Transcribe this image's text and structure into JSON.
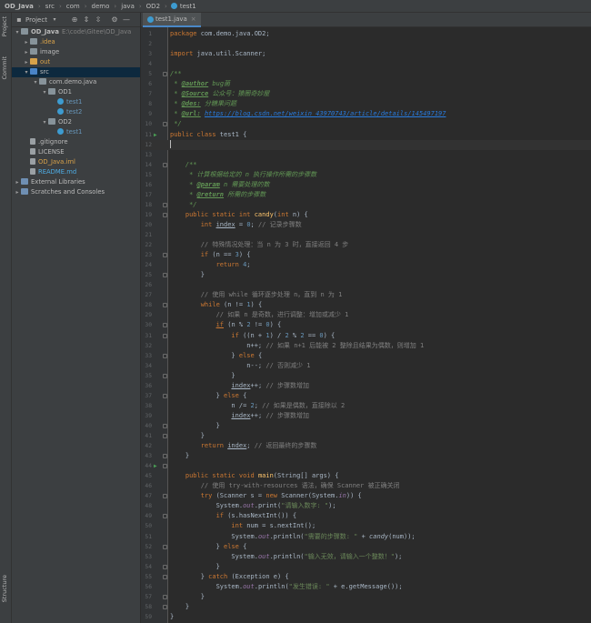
{
  "breadcrumb": [
    "OD_Java",
    "src",
    "com",
    "demo",
    "java",
    "OD2",
    "test1"
  ],
  "left_strip": {
    "top_tab": "Project",
    "commit_tab": "Commit",
    "bottom_tab": "Structure"
  },
  "project_panel": {
    "title": "Project",
    "tree": [
      {
        "indent": 0,
        "arrow": "▾",
        "icon": "folder",
        "label": "OD_Java",
        "extra": "E:\\code\\Gitee\\OD_Java",
        "bold": true
      },
      {
        "indent": 1,
        "arrow": "▸",
        "icon": "folder",
        "label": ".idea",
        "color": "orange"
      },
      {
        "indent": 1,
        "arrow": "▸",
        "icon": "folder",
        "label": "image"
      },
      {
        "indent": 1,
        "arrow": "▸",
        "icon": "folder-out",
        "label": "out",
        "color": "orange"
      },
      {
        "indent": 1,
        "arrow": "▾",
        "icon": "folder-src",
        "label": "src",
        "selected": true
      },
      {
        "indent": 2,
        "arrow": "▾",
        "icon": "pkg",
        "label": "com.demo.java"
      },
      {
        "indent": 3,
        "arrow": "▾",
        "icon": "pkg",
        "label": "OD1"
      },
      {
        "indent": 4,
        "arrow": "",
        "icon": "cls",
        "label": "test1",
        "color": "blue"
      },
      {
        "indent": 4,
        "arrow": "",
        "icon": "cls",
        "label": "test2",
        "color": "blue"
      },
      {
        "indent": 3,
        "arrow": "▾",
        "icon": "pkg",
        "label": "OD2"
      },
      {
        "indent": 4,
        "arrow": "",
        "icon": "cls",
        "label": "test1",
        "color": "blue"
      },
      {
        "indent": 1,
        "arrow": "",
        "icon": "file",
        "label": ".gitignore"
      },
      {
        "indent": 1,
        "arrow": "",
        "icon": "file",
        "label": "LICENSE"
      },
      {
        "indent": 1,
        "arrow": "",
        "icon": "file",
        "label": "OD_Java.iml",
        "color": "orange"
      },
      {
        "indent": 1,
        "arrow": "",
        "icon": "file",
        "label": "README.md",
        "color": "ml"
      },
      {
        "indent": 0,
        "arrow": "▸",
        "icon": "lib",
        "label": "External Libraries"
      },
      {
        "indent": 0,
        "arrow": "▸",
        "icon": "lib",
        "label": "Scratches and Consoles"
      }
    ]
  },
  "editor": {
    "tab_label": "test1.java",
    "lines": [
      [
        [
          "kw",
          "package "
        ],
        [
          "",
          "com.demo.java.OD2;"
        ]
      ],
      [],
      [
        [
          "kw",
          "import "
        ],
        [
          "",
          "java.util.Scanner;"
        ]
      ],
      [],
      [
        [
          "dc",
          "/**"
        ]
      ],
      [
        [
          "dc",
          " * "
        ],
        [
          "tg",
          "@author"
        ],
        [
          "dc",
          " bug菌"
        ]
      ],
      [
        [
          "dc",
          " * "
        ],
        [
          "tg",
          "@Source"
        ],
        [
          "dc",
          " 公众号：猿圈奇妙屋"
        ]
      ],
      [
        [
          "dc",
          " * "
        ],
        [
          "tg",
          "@des:"
        ],
        [
          "dc",
          " 分糖果问题"
        ]
      ],
      [
        [
          "dc",
          " * "
        ],
        [
          "tg",
          "@url:"
        ],
        [
          "dc",
          " "
        ],
        [
          "lnk",
          "https://blog.csdn.net/weixin_43970743/article/details/145497197"
        ]
      ],
      [
        [
          "dc",
          " */"
        ]
      ],
      [
        [
          "kw",
          "public class "
        ],
        [
          "",
          "test1 {"
        ]
      ],
      [],
      [],
      [
        [
          "dc",
          "    /**"
        ]
      ],
      [
        [
          "dc",
          "     * 计算根据给定的 n 执行操作所需的步骤数"
        ]
      ],
      [
        [
          "dc",
          "     * "
        ],
        [
          "tg",
          "@param"
        ],
        [
          "dc",
          " n 需要处理的数"
        ]
      ],
      [
        [
          "dc",
          "     * "
        ],
        [
          "tg",
          "@return"
        ],
        [
          "dc",
          " 所需的步骤数"
        ]
      ],
      [
        [
          "dc",
          "     */"
        ]
      ],
      [
        [
          "kw",
          "    public static int "
        ],
        [
          "fn",
          "candy"
        ],
        [
          "",
          "("
        ],
        [
          "kw",
          "int "
        ],
        [
          "",
          "n) {"
        ]
      ],
      [
        [
          "kw",
          "        int "
        ],
        [
          "ul",
          "index"
        ],
        [
          "",
          " = "
        ],
        [
          "num",
          "0"
        ],
        [
          "",
          ";"
        ],
        [
          "cm",
          " // 记录步骤数"
        ]
      ],
      [],
      [
        [
          "cm",
          "        // 特殊情况处理：当 n 为 3 时，直接返回 4 步"
        ]
      ],
      [
        [
          "kw",
          "        if "
        ],
        [
          "",
          "(n == "
        ],
        [
          "num",
          "3"
        ],
        [
          "",
          ") {"
        ]
      ],
      [
        [
          "kw",
          "            return "
        ],
        [
          "num",
          "4"
        ],
        [
          "",
          ";"
        ]
      ],
      [
        [
          "",
          "        }"
        ]
      ],
      [],
      [
        [
          "cm",
          "        // 使用 while 循环逐步处理 n，直到 n 为 1"
        ]
      ],
      [
        [
          "kw",
          "        while "
        ],
        [
          "",
          "(n != "
        ],
        [
          "num",
          "1"
        ],
        [
          "",
          ") {"
        ]
      ],
      [
        [
          "cm",
          "            // 如果 n 是奇数，进行调整：增加或减少 1"
        ]
      ],
      [
        [
          "kw",
          "            "
        ],
        [
          "kw ul",
          "if"
        ],
        [
          "",
          " (n % "
        ],
        [
          "num",
          "2"
        ],
        [
          "",
          " != "
        ],
        [
          "num",
          "0"
        ],
        [
          "",
          ") {"
        ]
      ],
      [
        [
          "kw",
          "                if "
        ],
        [
          "",
          "((n + "
        ],
        [
          "num",
          "1"
        ],
        [
          "",
          ") / "
        ],
        [
          "num",
          "2"
        ],
        [
          "",
          " % "
        ],
        [
          "num",
          "2"
        ],
        [
          "",
          " == "
        ],
        [
          "num",
          "0"
        ],
        [
          "",
          ") {"
        ]
      ],
      [
        [
          "",
          "                    n++;"
        ],
        [
          "cm",
          " // 如果 n+1 后能被 2 整除且结果为偶数，则增加 1"
        ]
      ],
      [
        [
          "",
          "                } "
        ],
        [
          "kw",
          "else "
        ],
        [
          "",
          "{"
        ]
      ],
      [
        [
          "",
          "                    n--;"
        ],
        [
          "cm",
          " // 否则减少 1"
        ]
      ],
      [
        [
          "",
          "                }"
        ]
      ],
      [
        [
          "",
          "                "
        ],
        [
          "ul",
          "index"
        ],
        [
          "",
          "++;"
        ],
        [
          "cm",
          " // 步骤数增加"
        ]
      ],
      [
        [
          "",
          "            } "
        ],
        [
          "kw",
          "else "
        ],
        [
          "",
          "{"
        ]
      ],
      [
        [
          "",
          "                n /= "
        ],
        [
          "num",
          "2"
        ],
        [
          "",
          ";"
        ],
        [
          "cm",
          " // 如果是偶数，直接除以 2"
        ]
      ],
      [
        [
          "",
          "                "
        ],
        [
          "ul",
          "index"
        ],
        [
          "",
          "++;"
        ],
        [
          "cm",
          " // 步骤数增加"
        ]
      ],
      [
        [
          "",
          "            }"
        ]
      ],
      [
        [
          "",
          "        }"
        ]
      ],
      [
        [
          "kw",
          "        return "
        ],
        [
          "ul",
          "index"
        ],
        [
          "",
          ";"
        ],
        [
          "cm",
          " // 返回最终的步骤数"
        ]
      ],
      [
        [
          "",
          "    }"
        ]
      ],
      [],
      [
        [
          "kw",
          "    public static void "
        ],
        [
          "fn",
          "main"
        ],
        [
          "",
          "(String[] args) {"
        ]
      ],
      [
        [
          "cm",
          "        // 使用 try-with-resources 语法，确保 Scanner 被正确关闭"
        ]
      ],
      [
        [
          "kw",
          "        try "
        ],
        [
          "",
          "(Scanner s = "
        ],
        [
          "kw",
          "new "
        ],
        [
          "",
          "Scanner(System."
        ],
        [
          "fld",
          "in"
        ],
        [
          "",
          ")) {"
        ]
      ],
      [
        [
          "",
          "            System."
        ],
        [
          "fld",
          "out"
        ],
        [
          "",
          ".print("
        ],
        [
          "str",
          "\"请输入数字: \""
        ],
        [
          "",
          ");"
        ]
      ],
      [
        [
          "kw",
          "            if "
        ],
        [
          "",
          "(s.hasNextInt()) {"
        ]
      ],
      [
        [
          "kw",
          "                int "
        ],
        [
          "",
          "num = s.nextInt();"
        ]
      ],
      [
        [
          "",
          "                System."
        ],
        [
          "fld",
          "out"
        ],
        [
          "",
          ".println("
        ],
        [
          "str",
          "\"需要的步骤数: \""
        ],
        [
          "",
          " + "
        ],
        [
          "it",
          "candy"
        ],
        [
          "",
          "(num));"
        ]
      ],
      [
        [
          "",
          "            } "
        ],
        [
          "kw",
          "else "
        ],
        [
          "",
          "{"
        ]
      ],
      [
        [
          "",
          "                System."
        ],
        [
          "fld",
          "out"
        ],
        [
          "",
          ".println("
        ],
        [
          "str",
          "\"输入无效，请输入一个整数！\""
        ],
        [
          "",
          ");"
        ]
      ],
      [
        [
          "",
          "            }"
        ]
      ],
      [
        [
          "",
          "        } "
        ],
        [
          "kw",
          "catch "
        ],
        [
          "",
          "(Exception e) {"
        ]
      ],
      [
        [
          "",
          "            System."
        ],
        [
          "fld",
          "out"
        ],
        [
          "",
          ".println("
        ],
        [
          "str",
          "\"发生错误: \""
        ],
        [
          "",
          " + e.getMessage());"
        ]
      ],
      [
        [
          "",
          "        }"
        ]
      ],
      [
        [
          "",
          "    }"
        ]
      ],
      [
        [
          "",
          "}"
        ]
      ],
      []
    ],
    "run_lines": [
      11,
      44
    ],
    "fold_lines": [
      5,
      10,
      14,
      18,
      19,
      23,
      25,
      28,
      30,
      31,
      33,
      35,
      37,
      40,
      41,
      43,
      44,
      47,
      49,
      52,
      54,
      55,
      57,
      58
    ],
    "current_line": 12
  }
}
